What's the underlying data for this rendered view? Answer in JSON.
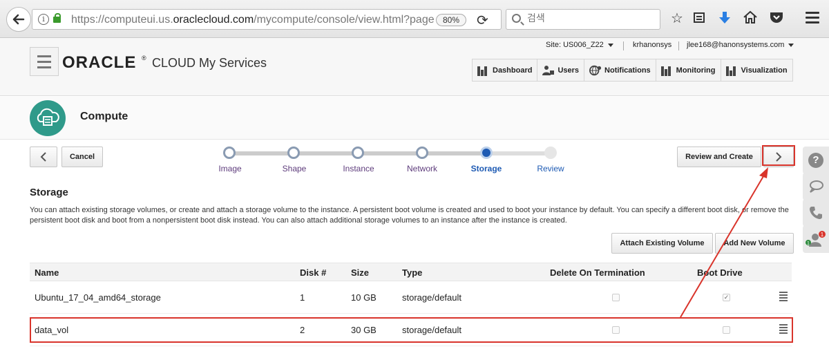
{
  "browser": {
    "url_host": "https://computeui.us.",
    "url_domain": "oraclecloud.com",
    "url_path": "/mycompute/console/view.html?page",
    "zoom": "80%",
    "search_placeholder": "검색"
  },
  "header": {
    "logo": "ORACLE",
    "product": "CLOUD My Services",
    "site": "Site: US006_Z22",
    "account": "krhanonsys",
    "user": "jlee168@hanonsystems.com",
    "nav": [
      {
        "label": "Dashboard"
      },
      {
        "label": "Users"
      },
      {
        "label": "Notifications"
      },
      {
        "label": "Monitoring"
      },
      {
        "label": "Visualization"
      }
    ]
  },
  "compute": {
    "title": "Compute"
  },
  "wizard": {
    "cancel_label": "Cancel",
    "review_create_label": "Review and Create",
    "steps": [
      {
        "label": "Image"
      },
      {
        "label": "Shape"
      },
      {
        "label": "Instance"
      },
      {
        "label": "Network"
      },
      {
        "label": "Storage"
      },
      {
        "label": "Review"
      }
    ],
    "current_step": "Storage"
  },
  "storage": {
    "title": "Storage",
    "description": "You can attach existing storage volumes, or create and attach a storage volume to the instance. A persistent boot volume is created and used to boot your instance by default. You can specify a different boot disk, or remove the persistent boot disk and boot from a nonpersistent boot disk instead. You can also attach additional storage volumes to an instance after the instance is created.",
    "attach_existing_label": "Attach Existing Volume",
    "add_new_label": "Add New Volume",
    "columns": [
      "Name",
      "Disk #",
      "Size",
      "Type",
      "Delete On Termination",
      "Boot Drive"
    ],
    "rows": [
      {
        "name": "Ubuntu_17_04_amd64_storage",
        "disk": "1",
        "size": "10 GB",
        "type": "storage/default",
        "delete_on_termination": false,
        "boot_drive": true
      },
      {
        "name": "data_vol",
        "disk": "2",
        "size": "30 GB",
        "type": "storage/default",
        "delete_on_termination": false,
        "boot_drive": false
      }
    ]
  },
  "side_panel": {
    "notification_counts": [
      "1",
      "1"
    ]
  },
  "colors": {
    "accent": "#1d5ab3",
    "compute_badge": "#2f9a8a",
    "annotation": "#d9342b",
    "step_label": "#5e3c7c"
  }
}
